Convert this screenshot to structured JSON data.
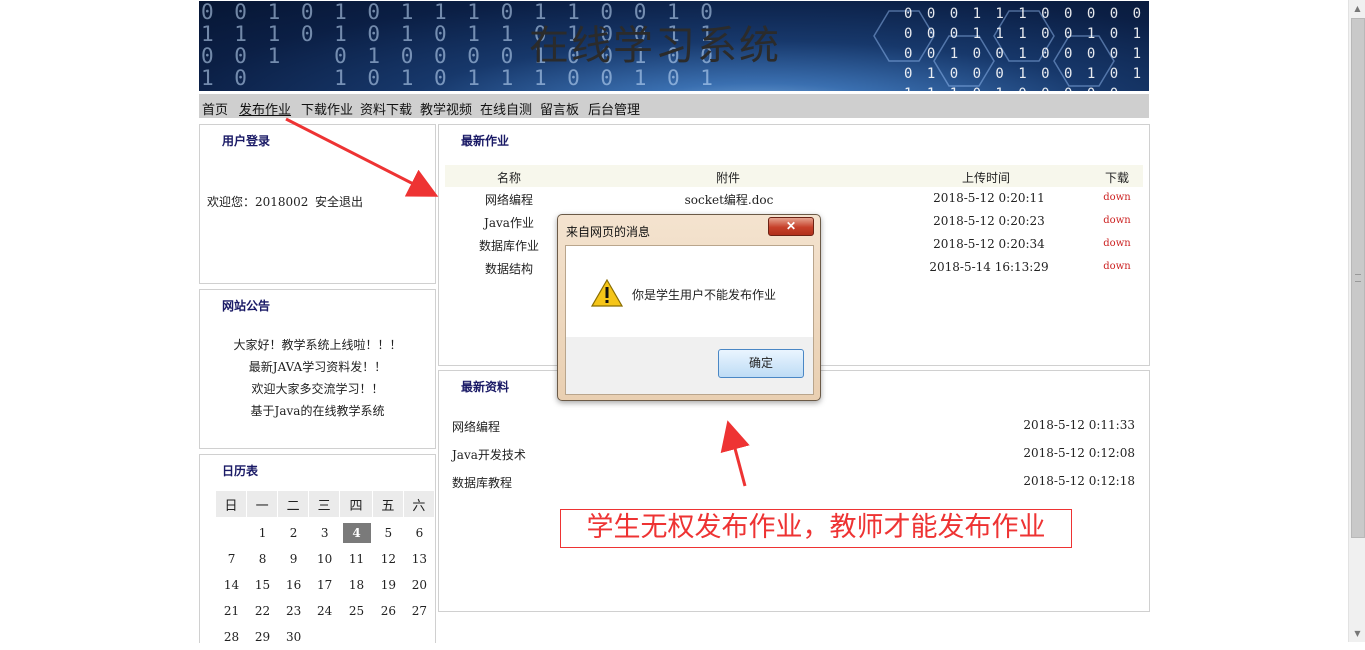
{
  "banner": {
    "title": "在线学习系统",
    "binary_left": "0 0 1 0 1 0 1 1 1 0 1 1 0 0 1 0\n1 1 1 0 1 0 1 0 1 1 0 1 0 0 1 1\n0 0 1   0 1 0 0 0 0 1 0 0 1 0 0\n1 0     1 0 1 0 1 1 1 0 0 1 0 1\n        0 1 0 1 0 0 0 0 0 0 1 1",
    "binary_right": "0 0 0 1 1 1 0 0 0 0 0 0\n0 0 0 1 1 1 0 0 1 0 1 0 1\n0 0 1 0 0 1 0 0 0 0 1 1\n0 1 0 0 0 1 0 0 1 0 1 0 0\n1 1 1 0 1 0 0 0 0 0"
  },
  "nav": {
    "items": [
      "首页",
      "发布作业",
      "下载作业",
      "资料下载",
      "教学视频",
      "在线自测",
      "留言板",
      "后台管理"
    ]
  },
  "login": {
    "title": "用户登录",
    "welcome": "欢迎您：2018002",
    "logout": "安全退出"
  },
  "notice": {
    "title": "网站公告",
    "lines": [
      "大家好！教学系统上线啦！！！",
      "最新JAVA学习资料发！！",
      "欢迎大家多交流学习！！",
      "基于Java的在线教学系统"
    ]
  },
  "calendar": {
    "title": "日历表",
    "weekdays": [
      "日",
      "一",
      "二",
      "三",
      "四",
      "五",
      "六"
    ],
    "weeks": [
      [
        "",
        "1",
        "2",
        "3",
        "4",
        "5",
        "6"
      ],
      [
        "7",
        "8",
        "9",
        "10",
        "11",
        "12",
        "13"
      ],
      [
        "14",
        "15",
        "16",
        "17",
        "18",
        "19",
        "20"
      ],
      [
        "21",
        "22",
        "23",
        "24",
        "25",
        "26",
        "27"
      ],
      [
        "28",
        "29",
        "30",
        "",
        "",
        "",
        ""
      ]
    ],
    "today": "4"
  },
  "homework": {
    "title": "最新作业",
    "columns": [
      "名称",
      "附件",
      "上传时间",
      "下载"
    ],
    "rows": [
      {
        "name": "网络编程",
        "attachment": "socket编程.doc",
        "time": "2018-5-12 0:20:11",
        "action": "down"
      },
      {
        "name": "Java作业",
        "attachment": "",
        "time": "2018-5-12 0:20:23",
        "action": "down"
      },
      {
        "name": "数据库作业",
        "attachment": "",
        "time": "2018-5-12 0:20:34",
        "action": "down"
      },
      {
        "name": "数据结构",
        "attachment": "",
        "time": "2018-5-14 16:13:29",
        "action": "down"
      }
    ]
  },
  "resources": {
    "title": "最新资料",
    "rows": [
      {
        "name": "网络编程",
        "time": "2018-5-12 0:11:33"
      },
      {
        "name": "Java开发技术",
        "time": "2018-5-12 0:12:08"
      },
      {
        "name": "数据库教程",
        "time": "2018-5-12 0:12:18"
      }
    ]
  },
  "dialog": {
    "title": "来自网页的消息",
    "close": "✕",
    "message": "你是学生用户不能发布作业",
    "ok": "确定"
  },
  "annotation": {
    "text": "学生无权发布作业，教师才能发布作业",
    "color": "#ee3333"
  },
  "scrollbar": {
    "up": "▲",
    "down": "▼"
  }
}
